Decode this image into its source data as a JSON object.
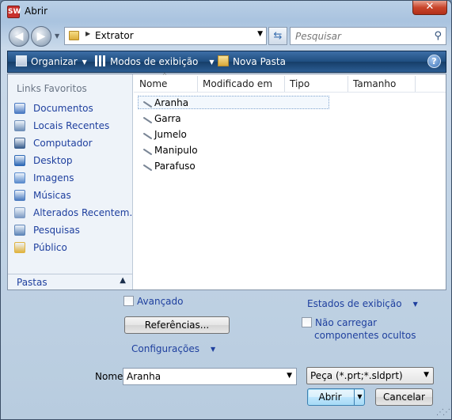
{
  "window": {
    "title": "Abrir",
    "app_icon_label": "SW",
    "close_label": "✕"
  },
  "address_bar": {
    "path": "Extrator",
    "search_placeholder": "Pesquisar"
  },
  "toolbar": {
    "organize_label": "Organizar",
    "views_label": "Modos de exibição",
    "new_folder_label": "Nova Pasta",
    "help_label": "?"
  },
  "nav_pane": {
    "favorites_header": "Links Favoritos",
    "items": [
      {
        "label": "Documentos",
        "icon": "documents-icon",
        "color": "#4a79c2"
      },
      {
        "label": "Locais Recentes",
        "icon": "recent-places-icon",
        "color": "#6f8fb8"
      },
      {
        "label": "Computador",
        "icon": "computer-icon",
        "color": "#3b5f8f"
      },
      {
        "label": "Desktop",
        "icon": "desktop-icon",
        "color": "#2d68b5"
      },
      {
        "label": "Imagens",
        "icon": "pictures-icon",
        "color": "#5b8ccd"
      },
      {
        "label": "Músicas",
        "icon": "music-icon",
        "color": "#4c7cc0"
      },
      {
        "label": "Alterados Recentem...",
        "icon": "recently-changed-icon",
        "color": "#7d9bc4"
      },
      {
        "label": "Pesquisas",
        "icon": "searches-icon",
        "color": "#5f86b8"
      },
      {
        "label": "Público",
        "icon": "public-folder-icon",
        "color": "#e0b33f"
      }
    ],
    "folders_label": "Pastas"
  },
  "file_pane": {
    "columns": [
      "Nome",
      "Modificado em",
      "Tipo",
      "Tamanho"
    ],
    "files": [
      {
        "name": "Aranha",
        "icon": "part-icon",
        "selected": true
      },
      {
        "name": "Garra",
        "icon": "part-icon",
        "selected": false
      },
      {
        "name": "Jumelo",
        "icon": "part-icon",
        "selected": false
      },
      {
        "name": "Manipulo",
        "icon": "part-icon",
        "selected": false
      },
      {
        "name": "Parafuso",
        "icon": "part-icon",
        "selected": false
      }
    ]
  },
  "options": {
    "advanced_label": "Avançado",
    "references_button": "Referências...",
    "display_states_label": "Estados de exibição",
    "config_label": "Configurações",
    "hidden_components_line1": "Não carregar",
    "hidden_components_line2": "componentes ocultos"
  },
  "footer": {
    "name_label": "Nome:",
    "name_value": "Aranha",
    "file_type": "Peça (*.prt;*.sldprt)",
    "open_button": "Abrir",
    "cancel_button": "Cancelar"
  }
}
